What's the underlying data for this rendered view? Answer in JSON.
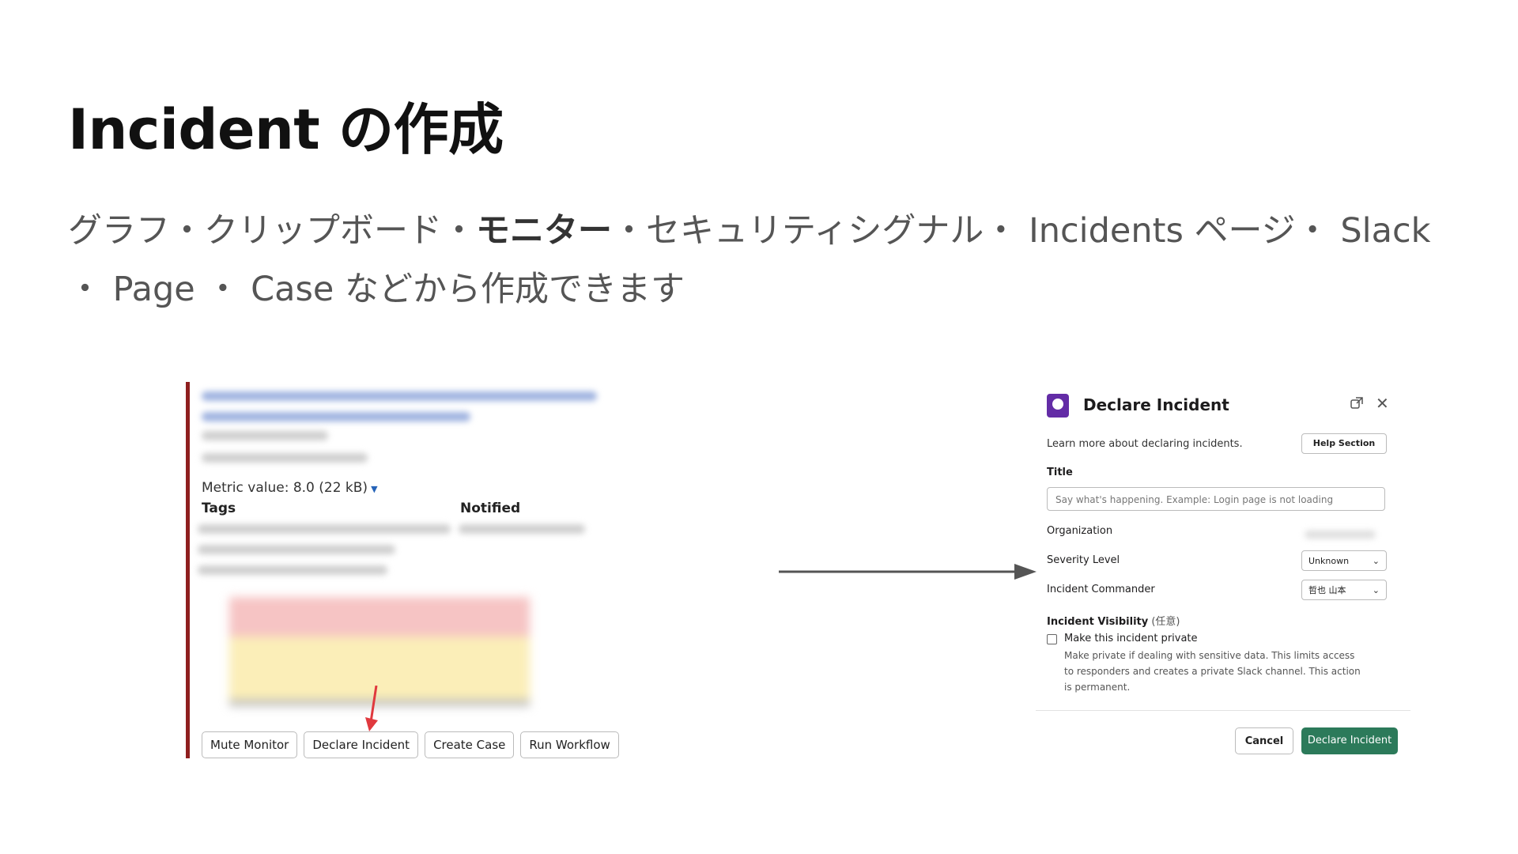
{
  "slide": {
    "title": "Incident の作成",
    "subtitle_part1": "グラフ・クリップボード・",
    "subtitle_bold": "モニター",
    "subtitle_part2": "・セキュリティシグナル・ Incidents ページ・ Slack ・ Page ・ Case などから作成できます"
  },
  "monitor_card": {
    "metric_label": "Metric value: 8.0 (22 kB)",
    "tags_header": "Tags",
    "notified_header": "Notified",
    "buttons": {
      "mute": "Mute Monitor",
      "declare": "Declare Incident",
      "create_case": "Create Case",
      "run_workflow": "Run Workflow"
    }
  },
  "modal": {
    "title": "Declare Incident",
    "learn_text": "Learn more about declaring incidents.",
    "help_button": "Help Section",
    "title_label": "Title",
    "title_placeholder": "Say what's happening. Example: Login page is not loading",
    "organization_label": "Organization",
    "severity_label": "Severity Level",
    "severity_value": "Unknown",
    "commander_label": "Incident Commander",
    "commander_value": "哲也 山本",
    "visibility_label": "Incident Visibility",
    "visibility_optional": "(任意)",
    "private_checkbox_label": "Make this incident private",
    "private_description": "Make private if dealing with sensitive data. This limits access to responders and creates a private Slack channel. This action is permanent.",
    "cancel_button": "Cancel",
    "declare_button": "Declare Incident"
  },
  "colors": {
    "accent_red_bar": "#8f1f1f",
    "declare_green": "#2c7a5a",
    "arrow_red": "#e0393e"
  }
}
